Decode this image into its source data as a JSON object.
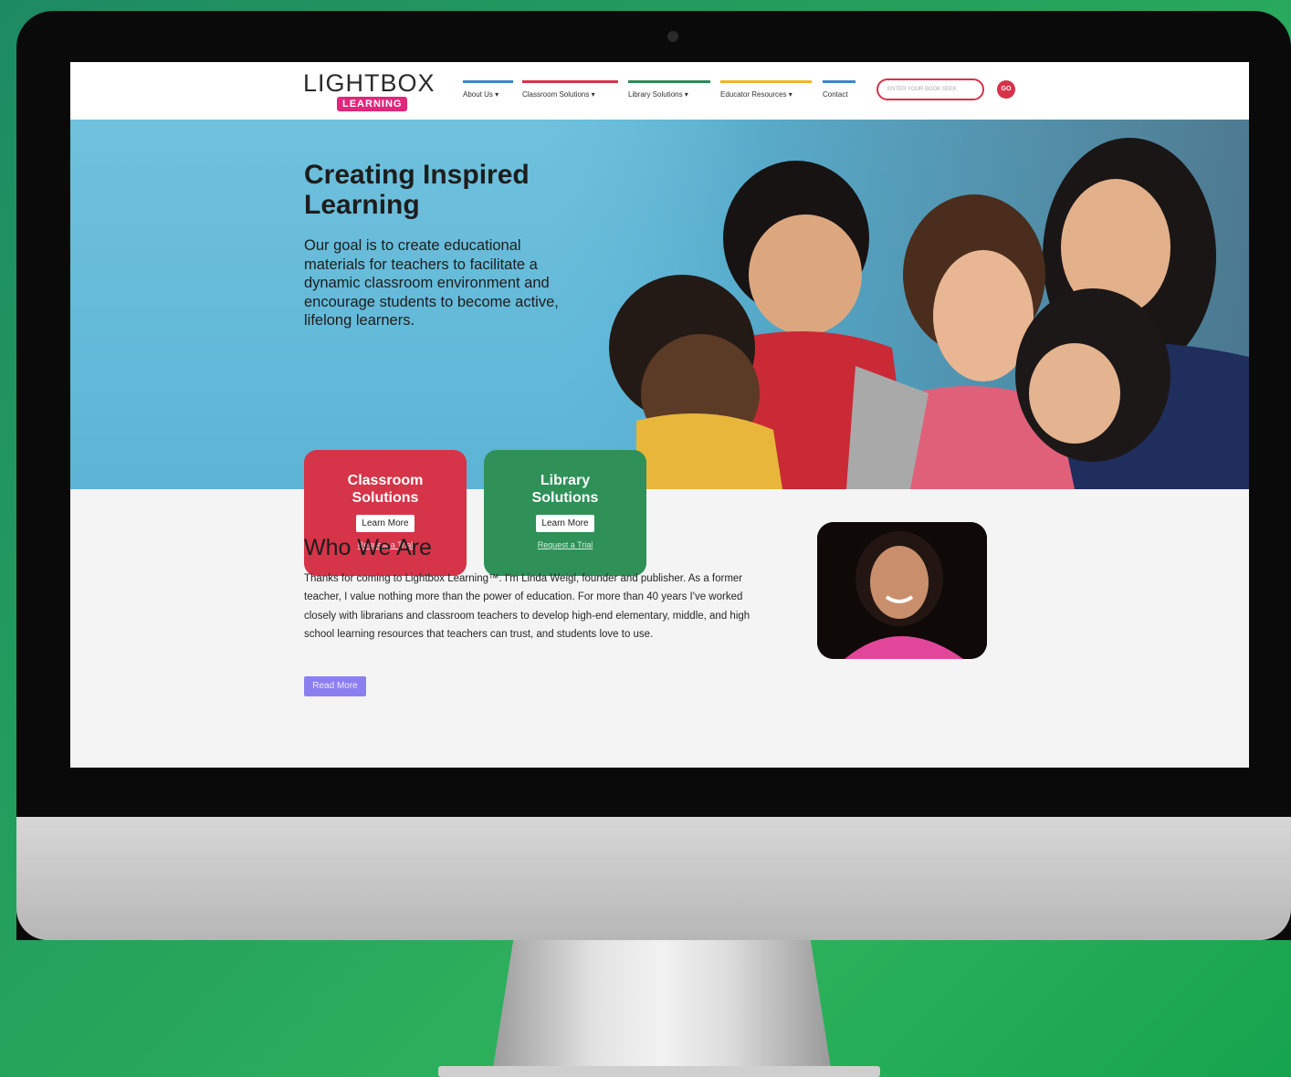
{
  "site": {
    "logo_text": "LIGHTBOX",
    "logo_badge": "LEARNING"
  },
  "nav": {
    "items": [
      {
        "label": "About Us ▾",
        "color": "#3a86c8"
      },
      {
        "label": "Classroom Solutions ▾",
        "color": "#d6334a"
      },
      {
        "label": "Library Solutions ▾",
        "color": "#2e8b57"
      },
      {
        "label": "Educator Resources ▾",
        "color": "#f2b42b"
      },
      {
        "label": "Contact",
        "color": "#3a86c8"
      }
    ],
    "search_placeholder": "ENTER YOUR BOOK SEEK",
    "go_label": "GO"
  },
  "hero": {
    "title": "Creating Inspired Learning",
    "text": "Our goal is to create educational materials for teachers to facilitate a dynamic classroom environment and encourage students to become active, lifelong learners."
  },
  "cards": [
    {
      "title": "Classroom Solutions",
      "button": "Learn More",
      "link": "Request a Trial",
      "color": "#d63448"
    },
    {
      "title": "Library Solutions",
      "button": "Learn More",
      "link": "Request a Trial",
      "color": "#2f9058"
    }
  ],
  "who": {
    "title": "Who We Are",
    "text": "Thanks for coming to Lightbox Learning™. I'm Linda Weigl, founder and publisher. As a former teacher, I value nothing more than the power of education. For more than 40 years I've worked closely with librarians and classroom teachers to develop high-end elementary, middle, and high school learning resources that teachers can trust, and students love to use.",
    "button": "Read More"
  }
}
